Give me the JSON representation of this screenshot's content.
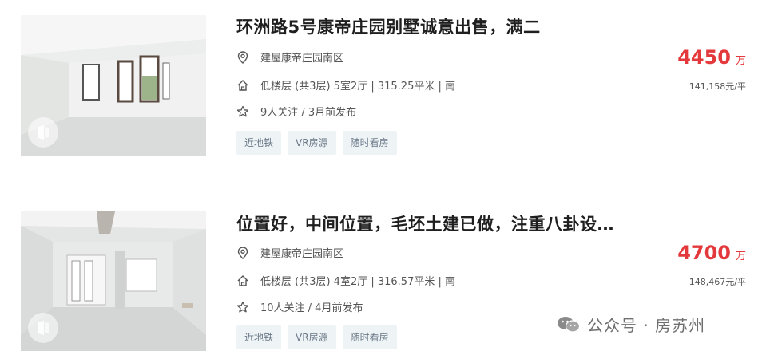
{
  "listings": [
    {
      "title": "环洲路5号康帝庄园别墅诚意出售，满二",
      "community": "建屋康帝庄园南区",
      "house_info": "低楼层 (共3层) 5室2厅 | 315.25平米 | 南",
      "follow_info": "9人关注 / 3月前发布",
      "tags": [
        "近地铁",
        "VR房源",
        "随时看房"
      ],
      "price": "4450",
      "price_unit": "万",
      "unit_price": "141,158元/平"
    },
    {
      "title": "位置好，中间位置，毛坯土建已做，注重八卦设…",
      "community": "建屋康帝庄园南区",
      "house_info": "低楼层 (共3层) 4室2厅 | 316.57平米 | 南",
      "follow_info": "10人关注 / 4月前发布",
      "tags": [
        "近地铁",
        "VR房源",
        "随时看房"
      ],
      "price": "4700",
      "price_unit": "万",
      "unit_price": "148,467元/平"
    }
  ],
  "watermark": {
    "text": "公众号 · 房苏州"
  },
  "icons": {
    "location": "location-pin-icon",
    "house": "house-icon",
    "follow": "star-icon",
    "vr": "vr-icon",
    "wechat": "wechat-icon"
  },
  "colors": {
    "price": "#e4393c",
    "tag_bg": "#eef3f6",
    "tag_text": "#6b7a88",
    "title": "#1f1f1f"
  }
}
